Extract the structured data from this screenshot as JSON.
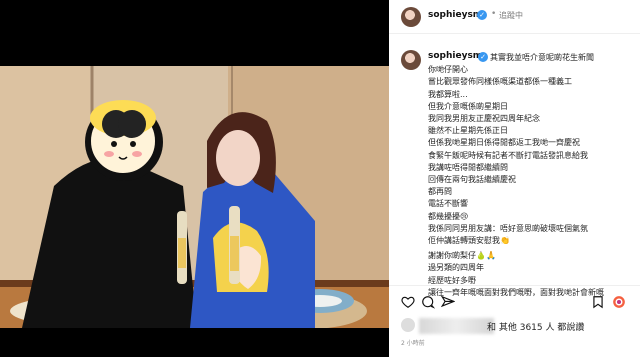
{
  "header": {
    "username": "sophieysm",
    "verified": "✓",
    "separator": "•",
    "follow_status": "追蹤中"
  },
  "caption": {
    "username": "sophieysm",
    "verified": "✓",
    "lines": [
      "其實我並唔介意呢啲花生新聞",
      "你哋仔開心",
      "嘗比觀眾發佈同樣係嘅渠道都係一種義工",
      "我都算啦...",
      "但我介意嘅係啲星期日",
      "我同我男朋友正慶祝四周年紀念",
      "雖然不止星期先係正日",
      "但係我哋星期日係得閒都返工我哋一齊慶祝",
      "食緊午飯呢時候有記者不斷打電話發訊息給我",
      "我講咗唔得閒都繼續問",
      "回傳在兩句我話繼續慶祝",
      "都再問",
      "電話不斷響",
      "都幾擾擾😢",
      "我係同同男朋友講：唔好意思啲破壞咗個氣氛",
      "佢仲講話轉頭安慰我👏",
      "",
      "謝謝你啲梨仔🍐🙏",
      "過另類的四周年",
      "經歷咗好多嘢",
      "讓往一齊年嘅嘅面對我們嘅嘢，面對我哋計會新嘅"
    ]
  },
  "actions": {
    "like_icon": "heart-icon",
    "comment_icon": "comment-icon",
    "share_icon": "send-icon",
    "save_icon": "bookmark-icon",
    "ig_icon": "instagram-icon"
  },
  "likes": {
    "text": "和 其他 3615 人 都說讚"
  },
  "time": {
    "text": "2 小時前"
  },
  "colors": {
    "accent": "#3897f0",
    "text": "#262626",
    "muted": "#8e8e8e"
  }
}
